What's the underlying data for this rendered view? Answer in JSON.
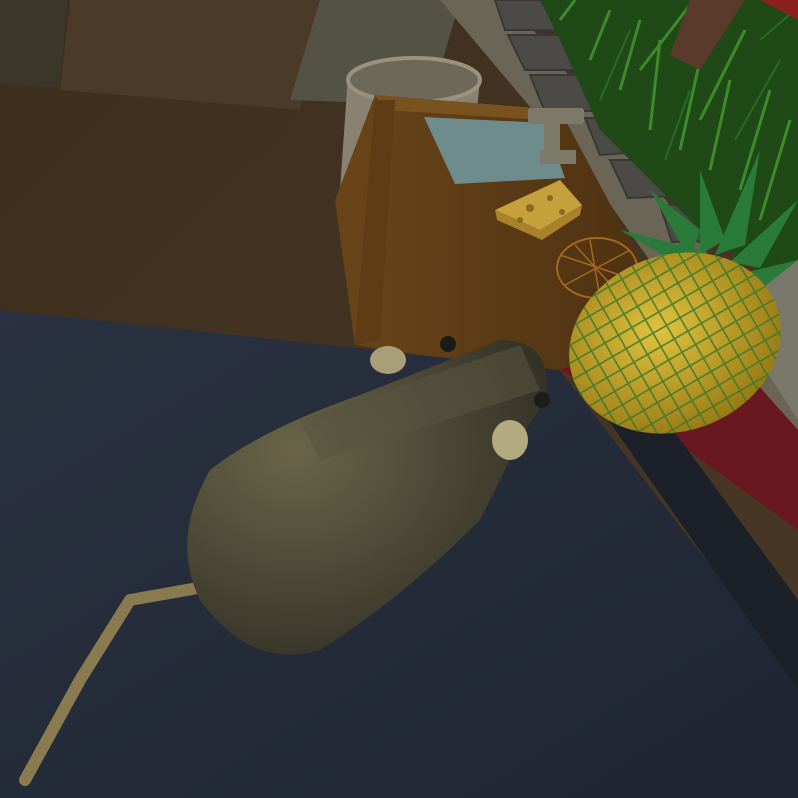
{
  "scene": {
    "kind": "3d-game-viewport",
    "objects": [
      "floor-area",
      "wooden-crate",
      "metal-bucket",
      "cheese-wedge",
      "wire-ball",
      "pineapple",
      "toy-mouse",
      "grass-patch",
      "stone-curb",
      "dark-table"
    ]
  },
  "palette": {
    "floor": "#3f3222",
    "table": "#252c3a",
    "crate": "#5a3a16",
    "crate_light": "#7a5220",
    "bucket": "#8a8270",
    "grass": "#1f4a18",
    "stone": "#4c4a46",
    "pineapple": "#b89a22",
    "pineapple_leaf": "#2a7a3a",
    "mouse": "#4a4838",
    "red_mat": "#6a1820",
    "cheese": "#c6a03a"
  }
}
